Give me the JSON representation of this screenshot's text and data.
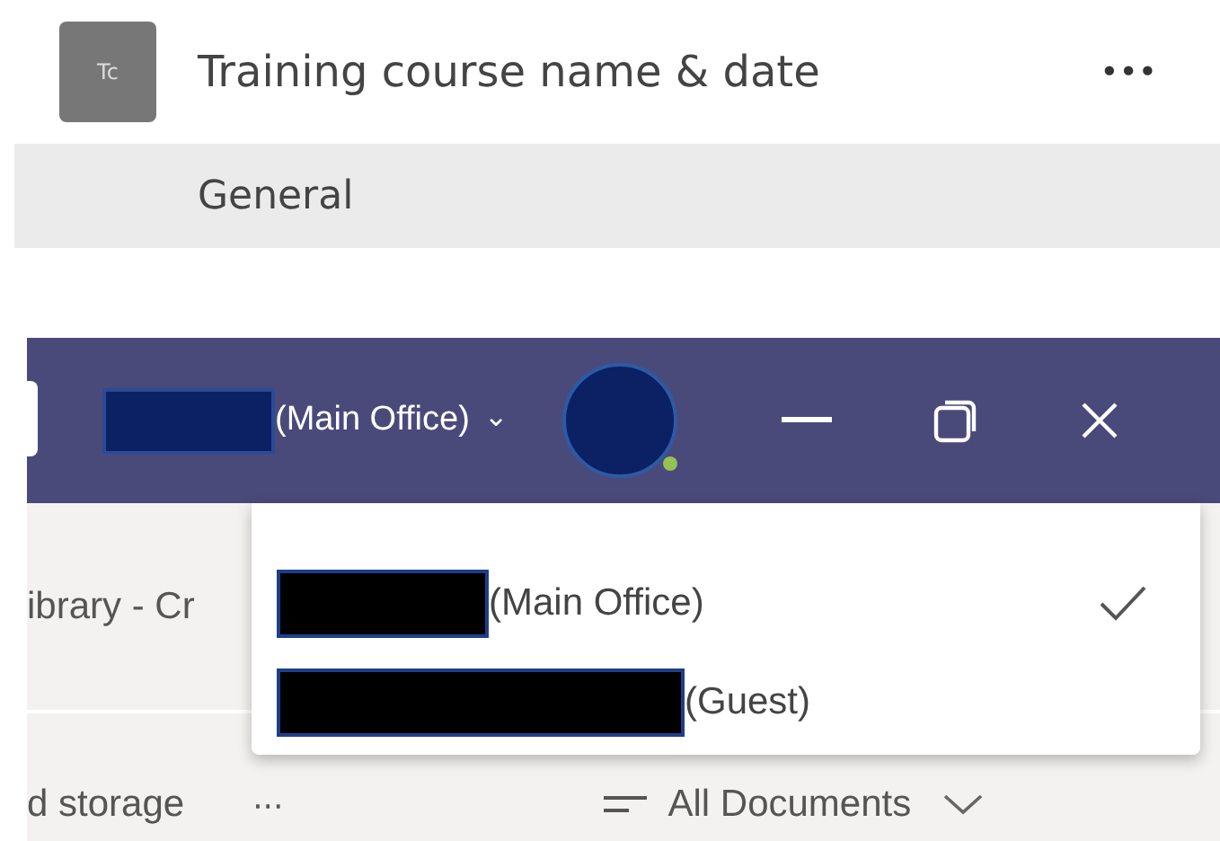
{
  "team": {
    "initials": "Tc",
    "name": "Training course name & date",
    "more": "•••"
  },
  "channels": [
    {
      "name": "General",
      "selected": true
    }
  ],
  "titlebar": {
    "account": "(Main Office)",
    "caret": "⌄"
  },
  "library": {
    "breadcrumb": "ibrary - Cr",
    "storage": "d storage",
    "more": "···",
    "view": "All Documents"
  },
  "account_menu": [
    {
      "label": "(Main Office)",
      "selected": true
    },
    {
      "label": "(Guest)",
      "selected": false
    }
  ]
}
